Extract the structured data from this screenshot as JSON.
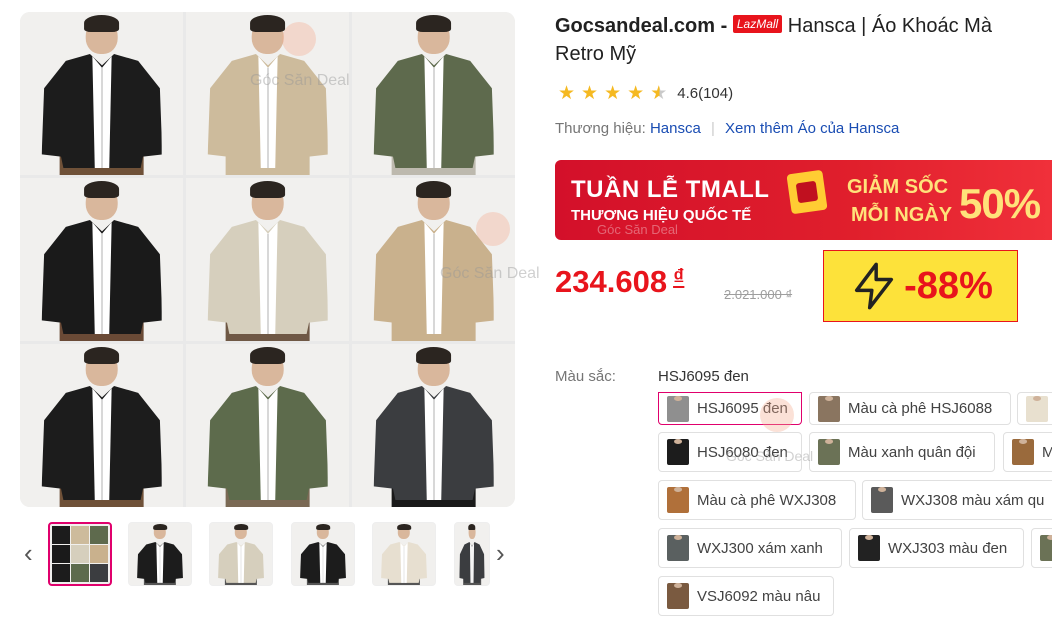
{
  "gallery": {
    "images": [
      {
        "jacket": "#1c1c1c",
        "shirt": "#ffffff",
        "pants": "#6f5138"
      },
      {
        "jacket": "#cdbb9c",
        "shirt": "#ffffff",
        "pants": "#cdbb9c"
      },
      {
        "jacket": "#5e6a4d",
        "shirt": "#ffffff",
        "pants": "#bdb9ae"
      },
      {
        "jacket": "#1a1a1a",
        "shirt": "#ffffff",
        "pants": "#6a4a36"
      },
      {
        "jacket": "#d6cfbd",
        "shirt": "#ffffff",
        "pants": "#6f5845"
      },
      {
        "jacket": "#c9b18d",
        "shirt": "#ffffff",
        "pants": "#c9b18d"
      },
      {
        "jacket": "#1c1c1c",
        "shirt": "#ffffff",
        "pants": "#6f5138"
      },
      {
        "jacket": "#5d6b4c",
        "shirt": "#ffffff",
        "pants": "#7a6954"
      },
      {
        "jacket": "#3b3d40",
        "shirt": "#ffffff",
        "pants": "#1a1a1a"
      }
    ],
    "watermark": "Góc Săn Deal",
    "watermark_2": "Góc Săn Deal",
    "thumbs": [
      {
        "jacket": "#4a4438"
      },
      {
        "jacket": "#1c1c1c"
      },
      {
        "jacket": "#d6cfbd"
      },
      {
        "jacket": "#1c1c1c"
      },
      {
        "jacket": "#e7dfd0"
      },
      {
        "jacket": "#3b3d40"
      }
    ],
    "prev_icon": "chevron-left-icon",
    "next_icon": "chevron-right-icon"
  },
  "product": {
    "site": "Gocsandeal.com -",
    "badge": "LazMall",
    "title_line1": "Hansca | Áo Khoác Mà",
    "title_line2": "Retro Mỹ",
    "rating_value": "4.6(104)",
    "rating_stars": 4.6,
    "brand_label": "Thương hiệu:",
    "brand_name": "Hansca",
    "brand_more": "Xem thêm Áo của Hansca"
  },
  "banner": {
    "line1": "TUẦN LỄ TMALL",
    "line2": "THƯƠNG HIỆU QUỐC TẾ",
    "line3": "GIẢM SỐC",
    "line4": "MỖI NGÀY",
    "line5": "50%",
    "watermark": "Góc Săn Deal"
  },
  "price": {
    "current": "234.608",
    "currency": "₫",
    "original": "2.021.000 ₫",
    "discount": "-88%",
    "discount_icon": "lightning-icon"
  },
  "colors": {
    "label": "Màu sắc:",
    "selected": "HSJ6095 đen",
    "options": [
      {
        "label": "HSJ6095 đen",
        "swatch": "#8f8f8f"
      },
      {
        "label": "Màu cà phê HSJ6088",
        "swatch": "#8a7560"
      },
      {
        "label": "",
        "swatch": "#e8e0cf"
      },
      {
        "label": "HSJ6080 đen",
        "swatch": "#1c1c1c"
      },
      {
        "label": "Màu xanh quân đội",
        "swatch": "#6b7256"
      },
      {
        "label": "M",
        "swatch": "#9a6a3c"
      },
      {
        "label": "Màu cà phê WXJ308",
        "swatch": "#b0703a"
      },
      {
        "label": "WXJ308 màu xám qu",
        "swatch": "#5a5a5a"
      },
      {
        "label": "WXJ300 xám xanh",
        "swatch": "#5a6060"
      },
      {
        "label": "WXJ303 màu đen",
        "swatch": "#222222"
      },
      {
        "label": "",
        "swatch": "#6b7256"
      },
      {
        "label": "VSJ6092 màu nâu",
        "swatch": "#7a5a40"
      }
    ]
  }
}
